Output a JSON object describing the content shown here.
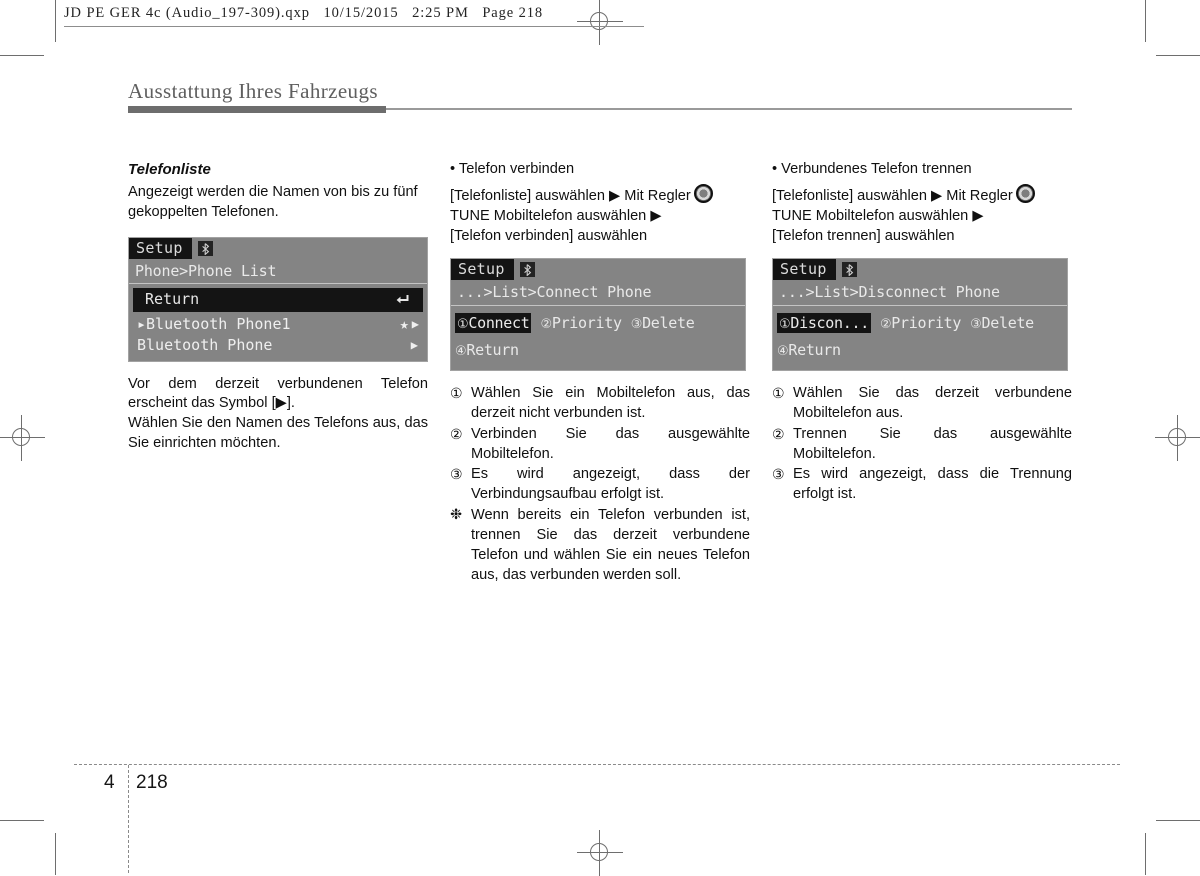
{
  "proof": {
    "header": "JD PE GER 4c (Audio_197-309).qxp   10/15/2015   2:25 PM   Page 218"
  },
  "page": {
    "chapter_title": "Ausstattung Ihres Fahrzeugs",
    "folio_chapter": "4",
    "folio_page": "218"
  },
  "col1": {
    "sub_head": "Telefonliste",
    "intro": "Angezeigt werden die Namen von bis zu fünf gekoppelten Telefonen.",
    "lcd": {
      "tab": "Setup",
      "bt_icon": "bluetooth-icon",
      "path": "Phone>Phone List",
      "rows": [
        {
          "label": "Return",
          "icon": "return-arrow-icon"
        },
        {
          "label": "▸Bluetooth Phone1",
          "icon": "star-icon",
          "icon2": "right-arrow-icon"
        },
        {
          "label": "Bluetooth Phone",
          "icon2": "right-arrow-icon"
        }
      ]
    },
    "para1": "Vor dem derzeit verbundenen Telefon erscheint das Symbol [▶].",
    "para2": "Wählen Sie den Namen des Telefons aus, das Sie einrichten möchten."
  },
  "col2": {
    "bullet_head": "• Telefon verbinden",
    "steps_line1": "[Telefonliste] auswählen ▶ Mit Regler",
    "steps_line2": "TUNE   Mobiltelefon   auswählen   ▶",
    "steps_line3": "[Telefon verbinden] auswählen",
    "lcd": {
      "tab": "Setup",
      "bt_icon": "bluetooth-icon",
      "path": "...>List>Connect Phone",
      "menu_row1": [
        {
          "num": "①",
          "label": "Connect",
          "selected": true
        },
        {
          "num": "②",
          "label": "Priority",
          "selected": false
        },
        {
          "num": "③",
          "label": "Delete",
          "selected": false
        }
      ],
      "menu_row2": [
        {
          "num": "④",
          "label": "Return",
          "selected": false
        }
      ]
    },
    "steps": [
      {
        "marker": "①",
        "text": "Wählen Sie ein Mobiltelefon aus, das derzeit nicht verbunden ist."
      },
      {
        "marker": "②",
        "text": "Verbinden Sie das ausgewählte Mobiltelefon."
      },
      {
        "marker": "③",
        "text": "Es wird angezeigt, dass der Verbindungsaufbau erfolgt ist."
      }
    ],
    "note_marker": "❉",
    "note_text": "Wenn bereits ein Telefon verbunden ist, trennen Sie das derzeit verbundene Telefon und wählen Sie ein neues Telefon aus, das verbunden werden soll."
  },
  "col3": {
    "bullet_head": "• Verbundenes Telefon trennen",
    "steps_line1": "[Telefonliste] auswählen ▶ Mit Regler",
    "steps_line2": "TUNE   Mobiltelefon   auswählen   ▶",
    "steps_line3": "[Telefon trennen] auswählen",
    "lcd": {
      "tab": "Setup",
      "bt_icon": "bluetooth-icon",
      "path": "...>List>Disconnect Phone",
      "menu_row1": [
        {
          "num": "①",
          "label": "Discon...",
          "selected": true
        },
        {
          "num": "②",
          "label": "Priority",
          "selected": false
        },
        {
          "num": "③",
          "label": "Delete",
          "selected": false
        }
      ],
      "menu_row2": [
        {
          "num": "④",
          "label": "Return",
          "selected": false
        }
      ]
    },
    "steps": [
      {
        "marker": "①",
        "text": "Wählen Sie das derzeit verbundene Mobiltelefon aus."
      },
      {
        "marker": "②",
        "text": "Trennen Sie das ausgewählte Mobiltelefon."
      },
      {
        "marker": "③",
        "text": "Es wird angezeigt, dass die Trennung erfolgt ist."
      }
    ]
  },
  "colors": {
    "lcd_background": "#848484",
    "lcd_highlight": "#141414",
    "title_gray": "#5f5f5f",
    "rule_gray": "#6d6d6d"
  }
}
